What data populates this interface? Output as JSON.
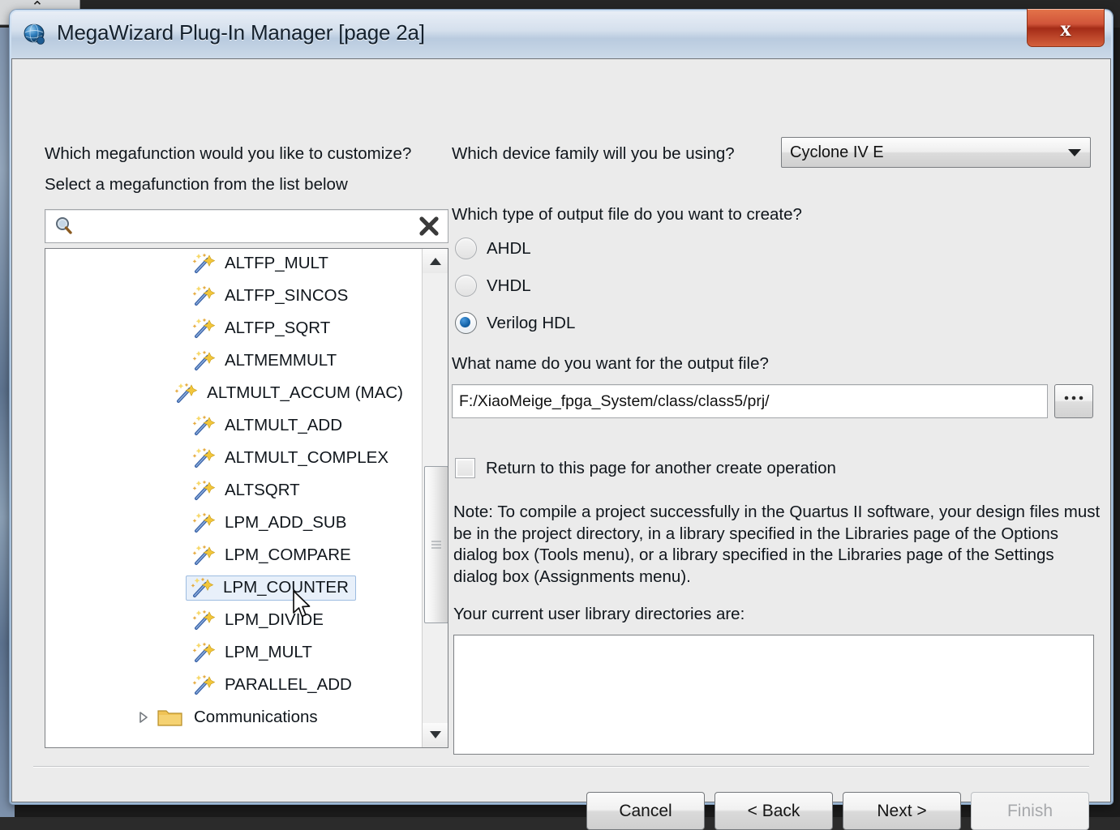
{
  "window": {
    "title": "MegaWizard Plug-In Manager [page 2a]",
    "app_icon": "quartus-globe-icon",
    "close_label": "x"
  },
  "background": {
    "chip_glyph": "⌃"
  },
  "left_pane": {
    "prompt_customize": "Which megafunction would you like to customize?",
    "prompt_select": "Select a megafunction from the list below",
    "search": {
      "value": "",
      "placeholder": ""
    },
    "list": {
      "selected": "LPM_COUNTER",
      "items": [
        {
          "label": "ALTFP_MULT",
          "type": "megafunction"
        },
        {
          "label": "ALTFP_SINCOS",
          "type": "megafunction"
        },
        {
          "label": "ALTFP_SQRT",
          "type": "megafunction"
        },
        {
          "label": "ALTMEMMULT",
          "type": "megafunction"
        },
        {
          "label": "ALTMULT_ACCUM (MAC)",
          "type": "megafunction"
        },
        {
          "label": "ALTMULT_ADD",
          "type": "megafunction"
        },
        {
          "label": "ALTMULT_COMPLEX",
          "type": "megafunction"
        },
        {
          "label": "ALTSQRT",
          "type": "megafunction"
        },
        {
          "label": "LPM_ADD_SUB",
          "type": "megafunction"
        },
        {
          "label": "LPM_COMPARE",
          "type": "megafunction"
        },
        {
          "label": "LPM_COUNTER",
          "type": "megafunction"
        },
        {
          "label": "LPM_DIVIDE",
          "type": "megafunction"
        },
        {
          "label": "LPM_MULT",
          "type": "megafunction"
        },
        {
          "label": "PARALLEL_ADD",
          "type": "megafunction"
        },
        {
          "label": "Communications",
          "type": "folder"
        }
      ]
    }
  },
  "right_pane": {
    "label_device_family": "Which device family will you be using?",
    "device_family_value": "Cyclone IV E",
    "label_output_type": "Which type of output file do you want to create?",
    "output_types": [
      {
        "label": "AHDL",
        "checked": false
      },
      {
        "label": "VHDL",
        "checked": false
      },
      {
        "label": "Verilog HDL",
        "checked": true
      }
    ],
    "label_output_name": "What name do you want for the output file?",
    "output_file_value": "F:/XiaoMeige_fpga_System/class/class5/prj/",
    "output_file_placeholder": "",
    "browse_label": "...",
    "return_checkbox": {
      "label": "Return to this page for another create operation",
      "checked": false
    },
    "note_text": "Note: To compile a project successfully in the Quartus II software, your design files must be in the project directory, in a library specified in the Libraries page of the Options dialog box (Tools menu), or a library specified in the Libraries page of the Settings dialog box (Assignments menu).",
    "label_user_libraries": "Your current user library directories are:",
    "user_library_value": ""
  },
  "footer": {
    "cancel_label": "Cancel",
    "back_label": "< Back",
    "next_label": "Next >",
    "finish_label": "Finish"
  },
  "colors": {
    "dialog_background": "#ebebeb",
    "selection_fill": "#e8f0fa",
    "selection_border": "#9dbce0",
    "radio_accent": "#1463a8",
    "close_button": "#a52c17"
  }
}
